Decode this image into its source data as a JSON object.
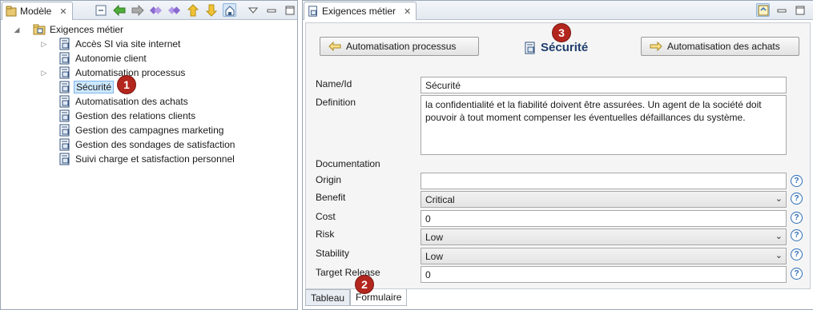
{
  "left_view": {
    "tab_label": "Modèle",
    "tree": {
      "root": "Exigences métier",
      "items": [
        {
          "label": "Accès SI via site internet",
          "expandable": true
        },
        {
          "label": "Autonomie client",
          "expandable": false
        },
        {
          "label": "Automatisation processus",
          "expandable": true
        },
        {
          "label": "Sécurité",
          "expandable": false,
          "selected": true
        },
        {
          "label": "Automatisation des achats",
          "expandable": false
        },
        {
          "label": "Gestion des relations clients",
          "expandable": false
        },
        {
          "label": "Gestion des campagnes marketing",
          "expandable": false
        },
        {
          "label": "Gestion des sondages de satisfaction",
          "expandable": false
        },
        {
          "label": "Suivi charge et satisfaction personnel",
          "expandable": false
        }
      ]
    },
    "toolbar_icons": [
      "collapse-all-icon",
      "back-arrow-icon",
      "forward-arrow-icon",
      "previous-diamond-icon",
      "next-diamond-icon",
      "up-arrow-icon",
      "down-arrow-icon",
      "link-with-editor-icon",
      "view-menu-icon",
      "minimize-icon",
      "maximize-icon"
    ]
  },
  "right_view": {
    "tab_label": "Exigences métier",
    "title": "Sécurité",
    "prev_button": "Automatisation processus",
    "next_button": "Automatisation des achats",
    "fields": {
      "name_label": "Name/Id",
      "name_value": "Sécurité",
      "definition_label": "Definition",
      "definition_value": "la confidentialité et la fiabilité doivent être assurées. Un agent de la société doit pouvoir à tout moment compenser les éventuelles défaillances du système.",
      "documentation_label": "Documentation",
      "origin_label": "Origin",
      "origin_value": "",
      "benefit_label": "Benefit",
      "benefit_value": "Critical",
      "cost_label": "Cost",
      "cost_value": "0",
      "risk_label": "Risk",
      "risk_value": "Low",
      "stability_label": "Stability",
      "stability_value": "Low",
      "target_release_label": "Target Release",
      "target_release_value": "0"
    },
    "bottom_tabs": [
      "Tableau",
      "Formulaire"
    ],
    "active_tab": "Formulaire"
  },
  "callouts": [
    "1",
    "2",
    "3"
  ],
  "colors": {
    "callout": "#b3261e",
    "selection": "#cde8ff",
    "title": "#1d3d6b",
    "help": "#2c6db5"
  }
}
